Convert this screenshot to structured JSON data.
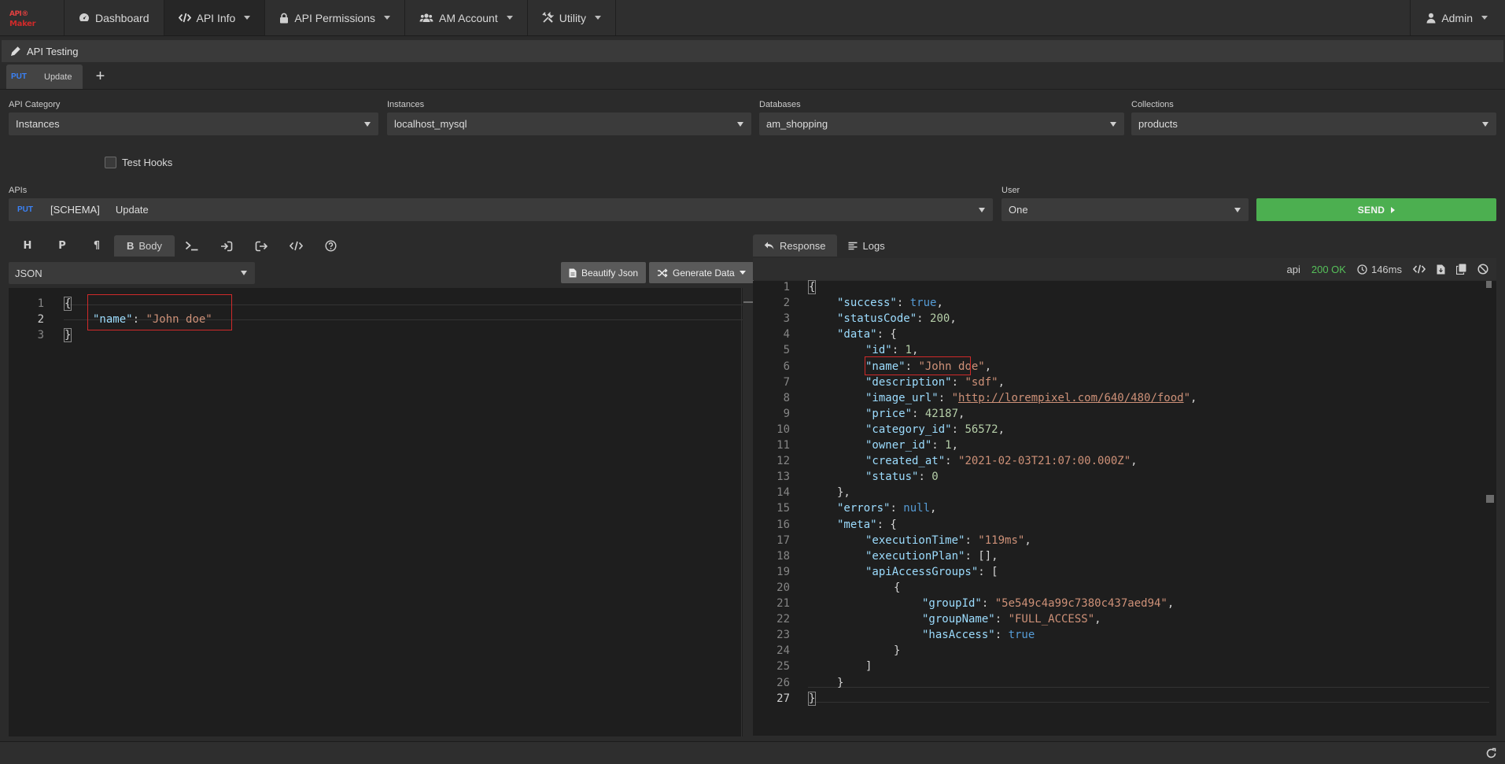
{
  "logo": {
    "top": "API",
    "top_suffix": "®",
    "bottom": "Maker"
  },
  "nav": {
    "items": [
      {
        "label": "Dashboard",
        "icon": "dashboard-icon"
      },
      {
        "label": "API Info",
        "icon": "code-icon"
      },
      {
        "label": "API Permissions",
        "icon": "lock-icon"
      },
      {
        "label": "AM Account",
        "icon": "users-icon"
      },
      {
        "label": "Utility",
        "icon": "tools-icon"
      }
    ],
    "user": "Admin"
  },
  "section": {
    "title": "API Testing"
  },
  "request_tab": {
    "method": "PUT",
    "label": "Update"
  },
  "add_tab": "+",
  "fields": {
    "api_category": {
      "label": "API Category",
      "value": "Instances"
    },
    "instances": {
      "label": "Instances",
      "value": "localhost_mysql"
    },
    "databases": {
      "label": "Databases",
      "value": "am_shopping"
    },
    "collections": {
      "label": "Collections",
      "value": "products"
    },
    "test_hooks": {
      "label": "Test Hooks"
    },
    "apis": {
      "label": "APIs",
      "method": "PUT",
      "schema": "[SCHEMA]",
      "name": "Update"
    },
    "user": {
      "label": "User",
      "value": "One"
    }
  },
  "send_label": "SEND",
  "editor_toolbar": {
    "body_label": "Body"
  },
  "format_select": "JSON",
  "beautify_label": "Beautify Json",
  "generate_label": "Generate Data",
  "request_lines": [
    {
      "n": "1",
      "tokens": [
        {
          "c": "p",
          "t": "{"
        }
      ]
    },
    {
      "n": "2",
      "tokens": [
        {
          "c": "k",
          "t": "\"name\""
        },
        {
          "c": "p",
          "t": ": "
        },
        {
          "c": "s",
          "t": "\"John doe\""
        }
      ]
    },
    {
      "n": "3",
      "tokens": [
        {
          "c": "p",
          "t": "}"
        }
      ]
    }
  ],
  "response_tabs": {
    "response": "Response",
    "logs": "Logs"
  },
  "response_meta": {
    "source": "api",
    "status": "200 OK",
    "time": "146ms"
  },
  "response_lines": [
    {
      "n": "1",
      "indent": 0,
      "tokens": [
        {
          "c": "p",
          "t": "{"
        }
      ]
    },
    {
      "n": "2",
      "indent": 1,
      "tokens": [
        {
          "c": "k",
          "t": "\"success\""
        },
        {
          "c": "p",
          "t": ": "
        },
        {
          "c": "b",
          "t": "true"
        },
        {
          "c": "p",
          "t": ","
        }
      ]
    },
    {
      "n": "3",
      "indent": 1,
      "tokens": [
        {
          "c": "k",
          "t": "\"statusCode\""
        },
        {
          "c": "p",
          "t": ": "
        },
        {
          "c": "n",
          "t": "200"
        },
        {
          "c": "p",
          "t": ","
        }
      ]
    },
    {
      "n": "4",
      "indent": 1,
      "tokens": [
        {
          "c": "k",
          "t": "\"data\""
        },
        {
          "c": "p",
          "t": ": {"
        }
      ]
    },
    {
      "n": "5",
      "indent": 2,
      "tokens": [
        {
          "c": "k",
          "t": "\"id\""
        },
        {
          "c": "p",
          "t": ": "
        },
        {
          "c": "n",
          "t": "1"
        },
        {
          "c": "p",
          "t": ","
        }
      ]
    },
    {
      "n": "6",
      "indent": 2,
      "tokens": [
        {
          "c": "k",
          "t": "\"name\""
        },
        {
          "c": "p",
          "t": ": "
        },
        {
          "c": "s",
          "t": "\"John doe\""
        },
        {
          "c": "p",
          "t": ","
        }
      ]
    },
    {
      "n": "7",
      "indent": 2,
      "tokens": [
        {
          "c": "k",
          "t": "\"description\""
        },
        {
          "c": "p",
          "t": ": "
        },
        {
          "c": "s",
          "t": "\"sdf\""
        },
        {
          "c": "p",
          "t": ","
        }
      ]
    },
    {
      "n": "8",
      "indent": 2,
      "tokens": [
        {
          "c": "k",
          "t": "\"image_url\""
        },
        {
          "c": "p",
          "t": ": "
        },
        {
          "c": "s",
          "t": "\""
        },
        {
          "c": "url",
          "t": "http://lorempixel.com/640/480/food"
        },
        {
          "c": "s",
          "t": "\""
        },
        {
          "c": "p",
          "t": ","
        }
      ]
    },
    {
      "n": "9",
      "indent": 2,
      "tokens": [
        {
          "c": "k",
          "t": "\"price\""
        },
        {
          "c": "p",
          "t": ": "
        },
        {
          "c": "n",
          "t": "42187"
        },
        {
          "c": "p",
          "t": ","
        }
      ]
    },
    {
      "n": "10",
      "indent": 2,
      "tokens": [
        {
          "c": "k",
          "t": "\"category_id\""
        },
        {
          "c": "p",
          "t": ": "
        },
        {
          "c": "n",
          "t": "56572"
        },
        {
          "c": "p",
          "t": ","
        }
      ]
    },
    {
      "n": "11",
      "indent": 2,
      "tokens": [
        {
          "c": "k",
          "t": "\"owner_id\""
        },
        {
          "c": "p",
          "t": ": "
        },
        {
          "c": "n",
          "t": "1"
        },
        {
          "c": "p",
          "t": ","
        }
      ]
    },
    {
      "n": "12",
      "indent": 2,
      "tokens": [
        {
          "c": "k",
          "t": "\"created_at\""
        },
        {
          "c": "p",
          "t": ": "
        },
        {
          "c": "s",
          "t": "\"2021-02-03T21:07:00.000Z\""
        },
        {
          "c": "p",
          "t": ","
        }
      ]
    },
    {
      "n": "13",
      "indent": 2,
      "tokens": [
        {
          "c": "k",
          "t": "\"status\""
        },
        {
          "c": "p",
          "t": ": "
        },
        {
          "c": "n",
          "t": "0"
        }
      ]
    },
    {
      "n": "14",
      "indent": 1,
      "tokens": [
        {
          "c": "p",
          "t": "},"
        }
      ]
    },
    {
      "n": "15",
      "indent": 1,
      "tokens": [
        {
          "c": "k",
          "t": "\"errors\""
        },
        {
          "c": "p",
          "t": ": "
        },
        {
          "c": "b",
          "t": "null"
        },
        {
          "c": "p",
          "t": ","
        }
      ]
    },
    {
      "n": "16",
      "indent": 1,
      "tokens": [
        {
          "c": "k",
          "t": "\"meta\""
        },
        {
          "c": "p",
          "t": ": {"
        }
      ]
    },
    {
      "n": "17",
      "indent": 2,
      "tokens": [
        {
          "c": "k",
          "t": "\"executionTime\""
        },
        {
          "c": "p",
          "t": ": "
        },
        {
          "c": "s",
          "t": "\"119ms\""
        },
        {
          "c": "p",
          "t": ","
        }
      ]
    },
    {
      "n": "18",
      "indent": 2,
      "tokens": [
        {
          "c": "k",
          "t": "\"executionPlan\""
        },
        {
          "c": "p",
          "t": ": [],"
        }
      ]
    },
    {
      "n": "19",
      "indent": 2,
      "tokens": [
        {
          "c": "k",
          "t": "\"apiAccessGroups\""
        },
        {
          "c": "p",
          "t": ": ["
        }
      ]
    },
    {
      "n": "20",
      "indent": 3,
      "tokens": [
        {
          "c": "p",
          "t": "{"
        }
      ]
    },
    {
      "n": "21",
      "indent": 4,
      "tokens": [
        {
          "c": "k",
          "t": "\"groupId\""
        },
        {
          "c": "p",
          "t": ": "
        },
        {
          "c": "s",
          "t": "\"5e549c4a99c7380c437aed94\""
        },
        {
          "c": "p",
          "t": ","
        }
      ]
    },
    {
      "n": "22",
      "indent": 4,
      "tokens": [
        {
          "c": "k",
          "t": "\"groupName\""
        },
        {
          "c": "p",
          "t": ": "
        },
        {
          "c": "s",
          "t": "\"FULL_ACCESS\""
        },
        {
          "c": "p",
          "t": ","
        }
      ]
    },
    {
      "n": "23",
      "indent": 4,
      "tokens": [
        {
          "c": "k",
          "t": "\"hasAccess\""
        },
        {
          "c": "p",
          "t": ": "
        },
        {
          "c": "b",
          "t": "true"
        }
      ]
    },
    {
      "n": "24",
      "indent": 3,
      "tokens": [
        {
          "c": "p",
          "t": "}"
        }
      ]
    },
    {
      "n": "25",
      "indent": 2,
      "tokens": [
        {
          "c": "p",
          "t": "]"
        }
      ]
    },
    {
      "n": "26",
      "indent": 1,
      "tokens": [
        {
          "c": "p",
          "t": "}"
        }
      ]
    },
    {
      "n": "27",
      "indent": 0,
      "tokens": [
        {
          "c": "p",
          "t": "}"
        }
      ]
    }
  ],
  "colors": {
    "put": "#3b82f6",
    "send": "#4caf50",
    "ok": "#56c05a",
    "highlight": "#d02a2a"
  }
}
